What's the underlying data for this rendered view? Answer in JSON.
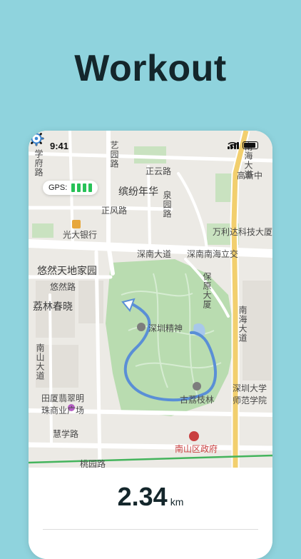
{
  "headline": "Workout",
  "status": {
    "time": "9:41"
  },
  "gps": {
    "label": "GPS:",
    "bars": 4
  },
  "map": {
    "labels": [
      "学府路",
      "艺园路",
      "正云路",
      "缤纷年华",
      "泉园路",
      "正风路",
      "光大银行",
      "深南大道",
      "深南南海立交",
      "高新中",
      "南海大道",
      "万利达科技大厦",
      "悠然天地家园",
      "悠然路",
      "荔林春晓",
      "深圳精神",
      "南山大道",
      "田厦翡翠明珠商业广场",
      "古荔枝林",
      "深圳大学师范学院",
      "慧学路",
      "南山区政府",
      "桃园路",
      "南海大道",
      "保原大厦"
    ]
  },
  "workout": {
    "distance": "2.34",
    "unit": "km"
  },
  "colors": {
    "background": "#8fd3dd",
    "route": "#5a8fd6",
    "gps_bar": "#28c258"
  }
}
